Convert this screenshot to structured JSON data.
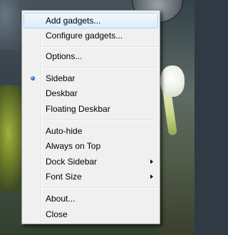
{
  "menu": {
    "add_gadgets": "Add gadgets...",
    "configure_gadgets": "Configure gadgets...",
    "options": "Options...",
    "sidebar": "Sidebar",
    "deskbar": "Deskbar",
    "floating_deskbar": "Floating Deskbar",
    "auto_hide": "Auto-hide",
    "always_on_top": "Always on Top",
    "dock_sidebar": "Dock Sidebar",
    "font_size": "Font Size",
    "about": "About...",
    "close": "Close",
    "selected_mode": "Sidebar",
    "highlighted_item": "Add gadgets..."
  },
  "icons": {
    "radio_selected": "radio-selected-icon",
    "submenu_arrow": "submenu-arrow-icon"
  }
}
